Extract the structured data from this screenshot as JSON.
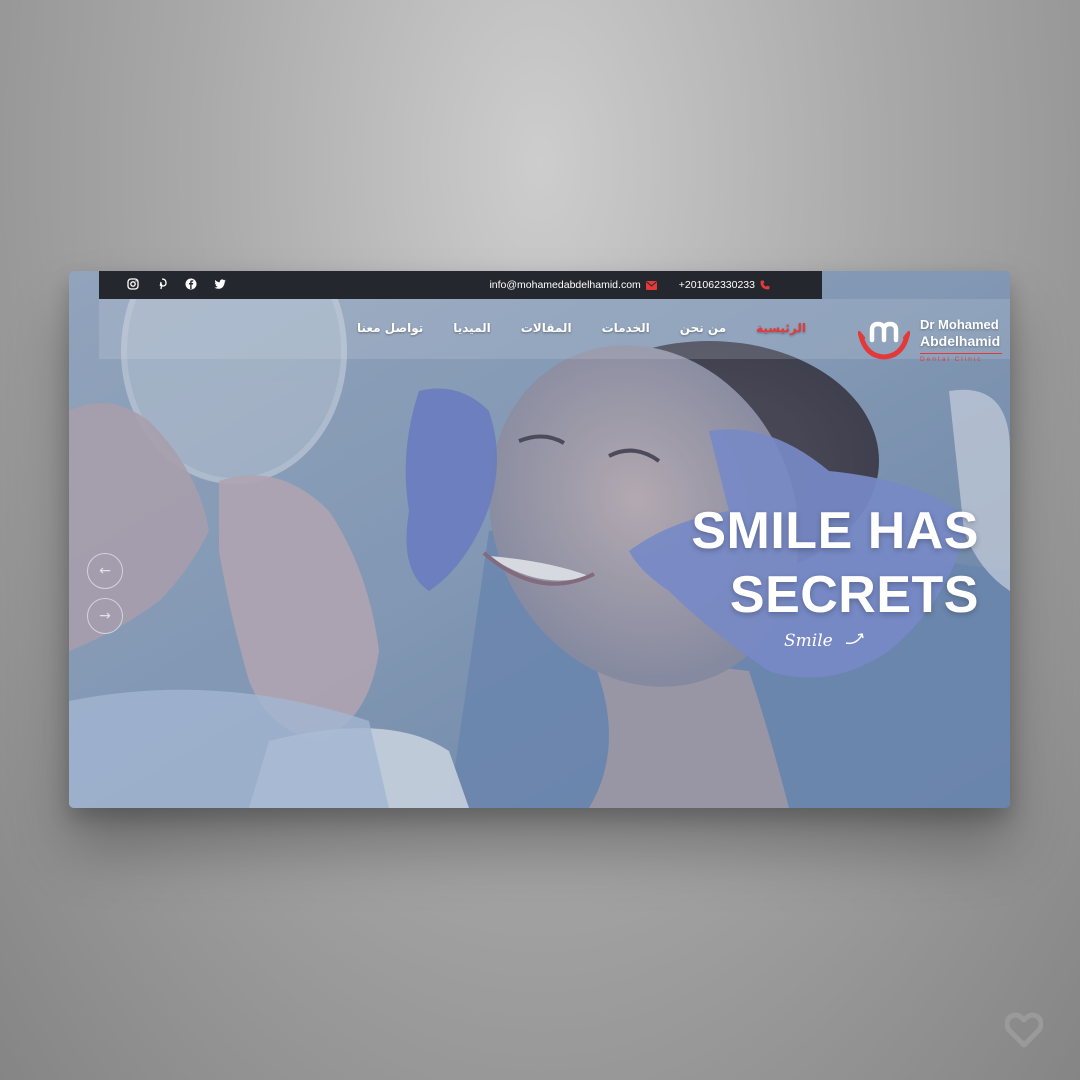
{
  "topbar": {
    "phone": "+201062330233",
    "email": "info@mohamedabdelhamid.com",
    "social": [
      "instagram-icon",
      "pinterest-icon",
      "facebook-icon",
      "twitter-icon"
    ]
  },
  "nav": {
    "items": [
      "تواصل معنا",
      "الميديا",
      "المقالات",
      "الخدمات",
      "من نحن",
      "الرئيسية"
    ],
    "active": "الرئيسية"
  },
  "logo": {
    "line1": "Dr Mohamed",
    "line2": "Abdelhamid",
    "tagline": "Dental Clinic"
  },
  "hero": {
    "headline_1": "SMILE HAS",
    "headline_2": "SECRETS",
    "script": "Smile"
  },
  "slider": {
    "prev_icon": "arrow-left-icon",
    "next_icon": "arrow-right-icon"
  },
  "colors": {
    "accent": "#e23a3a",
    "topbar": "#24282e",
    "overlay": "#7d93ae"
  }
}
